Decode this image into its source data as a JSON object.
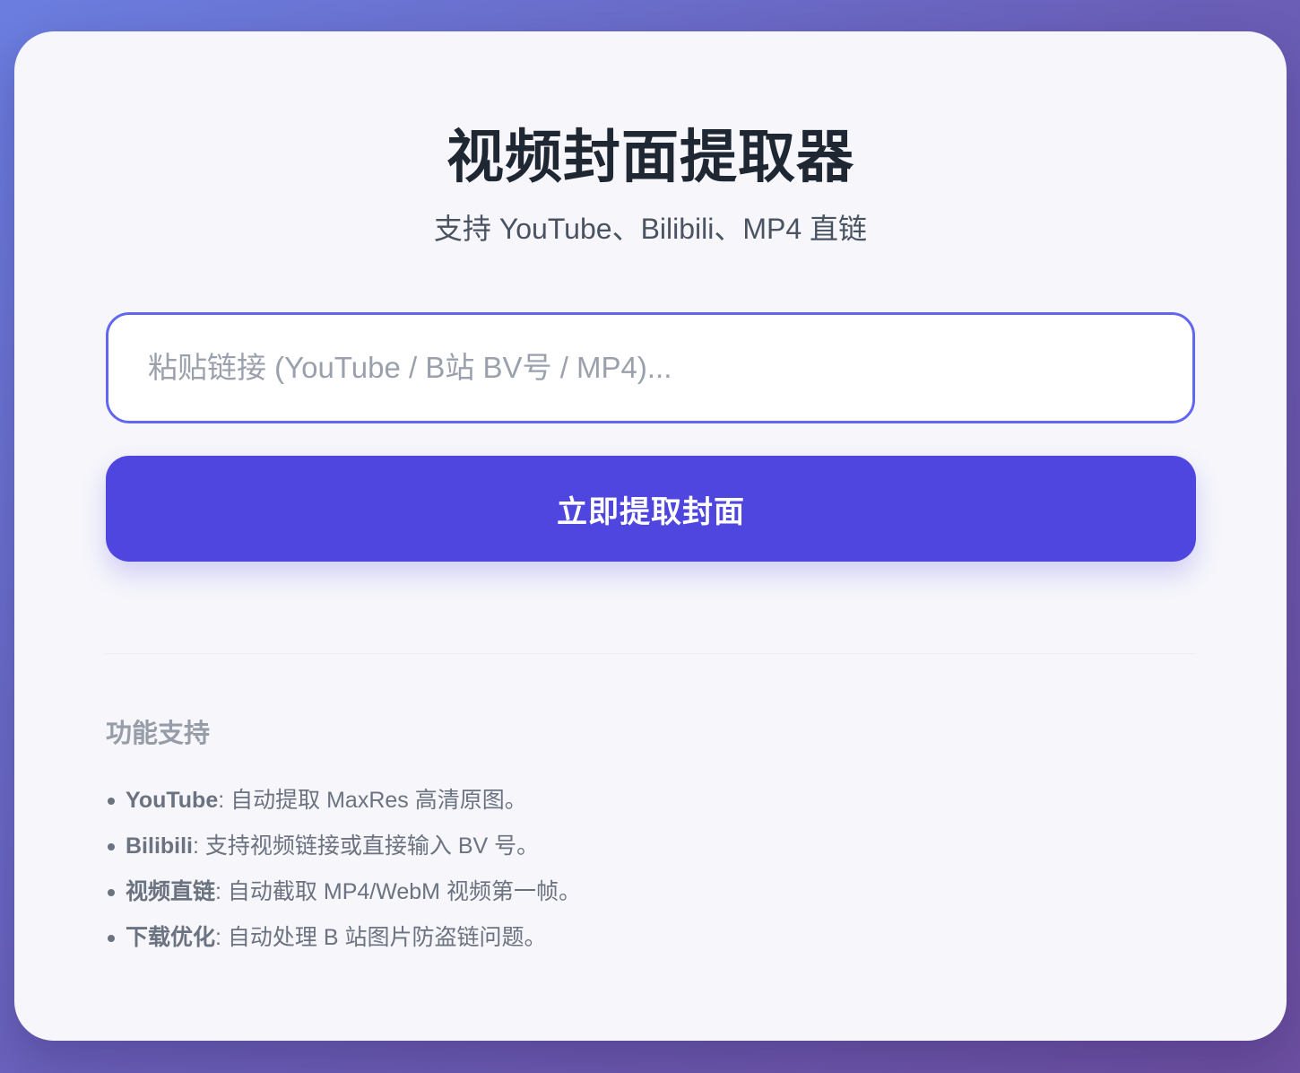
{
  "app": {
    "title": "视频封面提取器",
    "subtitle": "支持 YouTube、Bilibili、MP4 直链"
  },
  "input": {
    "placeholder": "粘贴链接 (YouTube / B站 BV号 / MP4)...",
    "value": ""
  },
  "button": {
    "label": "立即提取封面"
  },
  "features": {
    "heading": "功能支持",
    "items": [
      {
        "name": "YouTube",
        "sep": ": ",
        "desc": "自动提取 MaxRes 高清原图。"
      },
      {
        "name": "Bilibili",
        "sep": ": ",
        "desc": "支持视频链接或直接输入 BV 号。"
      },
      {
        "name": "视频直链",
        "sep": ": ",
        "desc": "自动截取 MP4/WebM 视频第一帧。"
      },
      {
        "name": "下载优化",
        "sep": ": ",
        "desc": "自动处理 B 站图片防盗链问题。"
      }
    ]
  },
  "colors": {
    "accent": "#4f46e0",
    "input_border": "#6366f1",
    "card_background": "#f6f6fb",
    "page_gradient_start": "#6b7ee0",
    "page_gradient_end": "#6d4fa0"
  }
}
